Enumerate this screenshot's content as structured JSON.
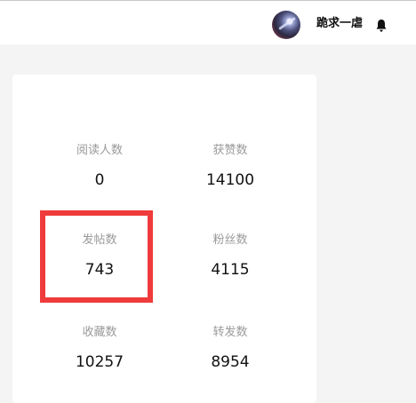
{
  "header": {
    "username": "跪求一虐",
    "avatar_icon": "user-avatar",
    "bell_icon": "bell-icon"
  },
  "stats": [
    {
      "label": "阅读人数",
      "value": "0"
    },
    {
      "label": "获赞数",
      "value": "14100"
    },
    {
      "label": "发帖数",
      "value": "743"
    },
    {
      "label": "粉丝数",
      "value": "4115"
    },
    {
      "label": "收藏数",
      "value": "10257"
    },
    {
      "label": "转发数",
      "value": "8954"
    }
  ],
  "colors": {
    "highlight": "#ef3b3b",
    "label": "#999999",
    "value": "#111111",
    "page_bg": "#f4f4f5"
  }
}
